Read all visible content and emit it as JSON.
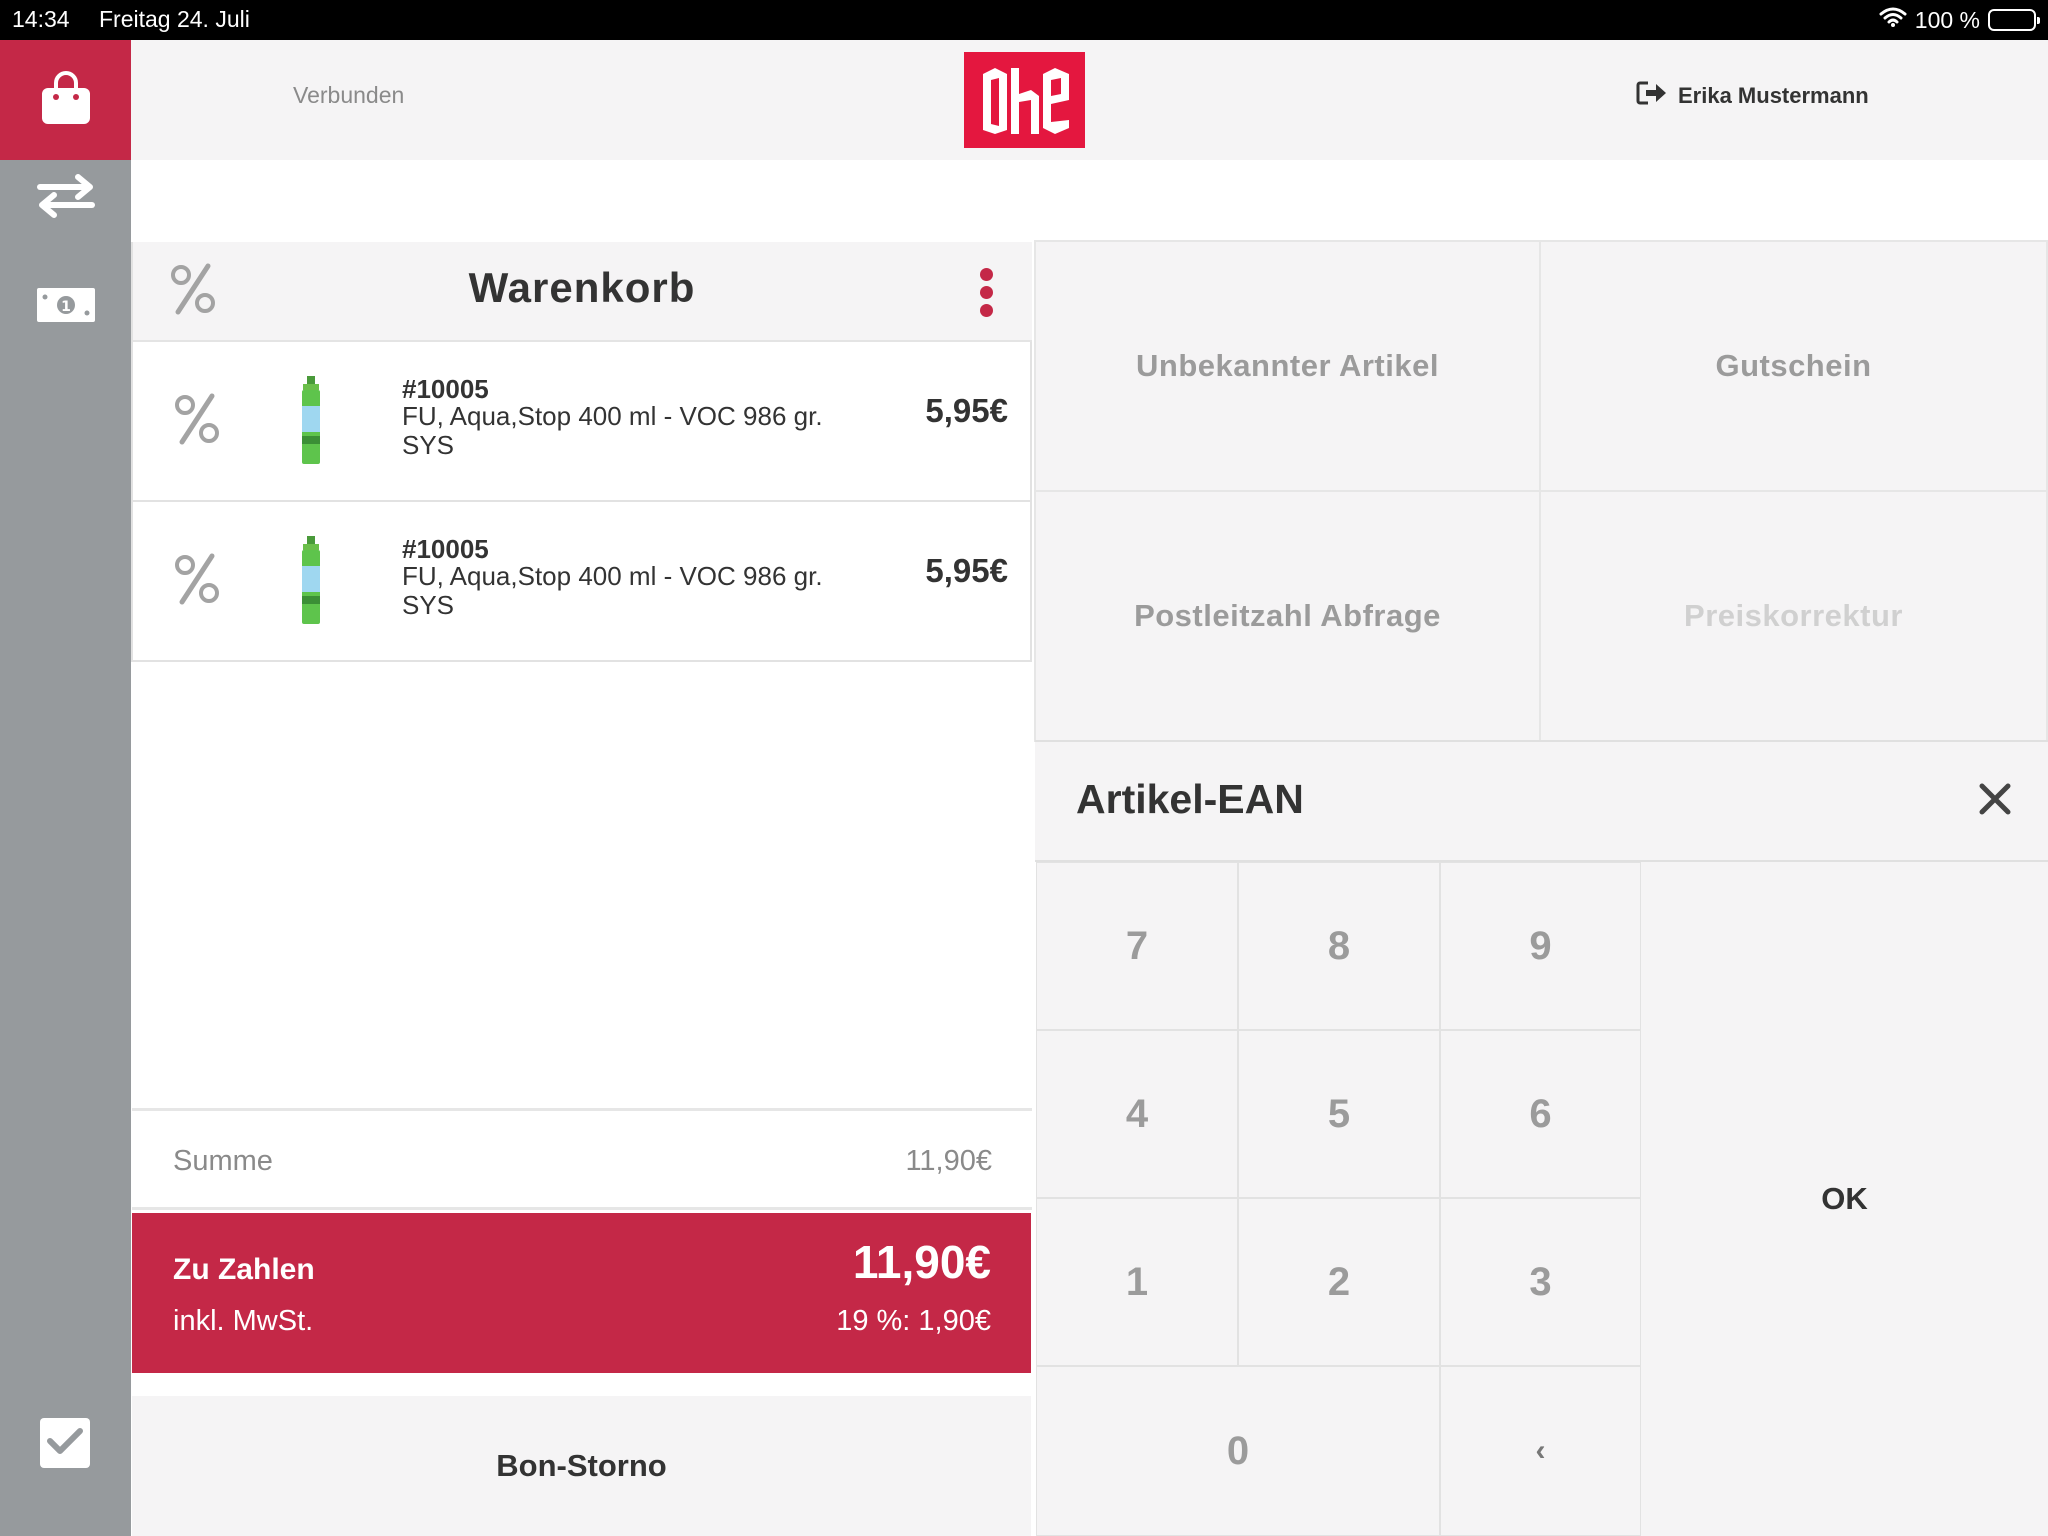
{
  "status_bar": {
    "time": "14:34",
    "date": "Freitag 24. Juli",
    "battery": "100 %",
    "battery_level": 1.0
  },
  "header": {
    "connection_status": "Verbunden",
    "user_name": "Erika Mustermann"
  },
  "colors": {
    "brand_red": "#c42847",
    "logo_red": "#e4173f",
    "sidebar_gray": "#969a9d"
  },
  "sidebar": {
    "items": [
      {
        "icon": "shopping-bag-icon",
        "active": true
      },
      {
        "icon": "exchange-arrows-icon",
        "active": false
      },
      {
        "icon": "banknote-icon",
        "active": false
      },
      {
        "icon": "checkbox-icon",
        "active": false
      }
    ]
  },
  "cart": {
    "title": "Warenkorb",
    "items": [
      {
        "sku": "#10005",
        "description": "FU, Aqua,Stop 400 ml - VOC 986 gr. SYS",
        "price": "5,95€"
      },
      {
        "sku": "#10005",
        "description": "FU, Aqua,Stop 400 ml - VOC 986 gr. SYS",
        "price": "5,95€"
      }
    ],
    "summe_label": "Summe",
    "summe_value": "11,90€",
    "pay_label": "Zu Zahlen",
    "pay_total": "11,90€",
    "vat_label": "inkl. MwSt.",
    "vat_value": "19 %: 1,90€",
    "storno_label": "Bon-Storno"
  },
  "actions": {
    "unknown_item": "Unbekannter Artikel",
    "voucher": "Gutschein",
    "zip_query": "Postleitzahl Abfrage",
    "price_correction": "Preiskorrektur"
  },
  "keypad": {
    "title": "Artikel-EAN",
    "keys": {
      "k7": "7",
      "k8": "8",
      "k9": "9",
      "k4": "4",
      "k5": "5",
      "k6": "6",
      "k1": "1",
      "k2": "2",
      "k3": "3",
      "k0": "0",
      "backspace": "‹",
      "ok": "OK"
    }
  }
}
